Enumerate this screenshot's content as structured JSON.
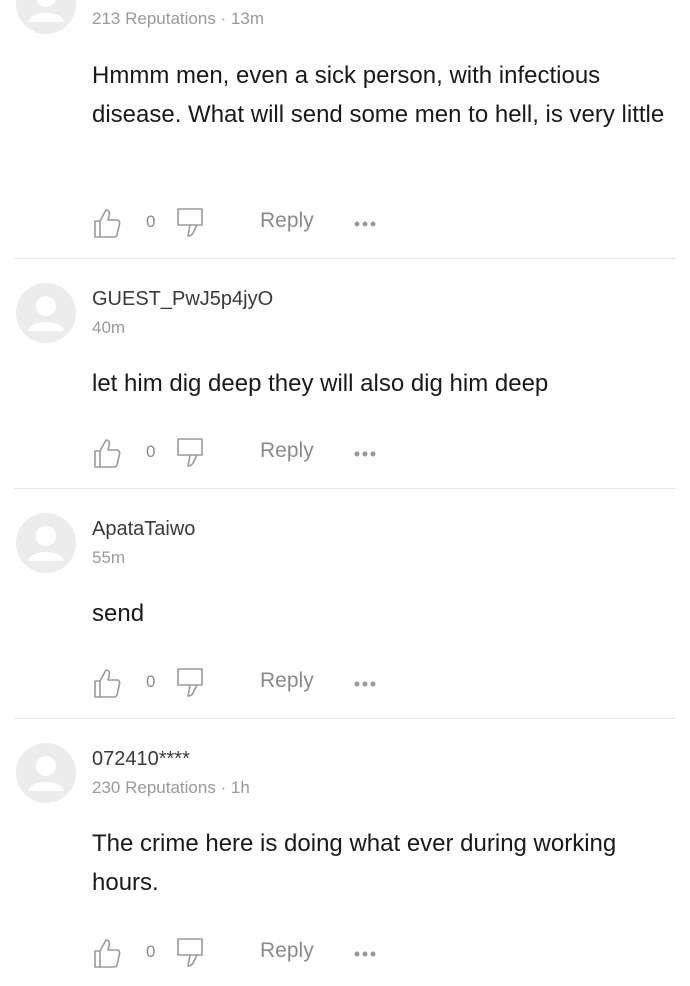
{
  "comments": [
    {
      "author": "",
      "meta": "213 Reputations · 13m",
      "text": "Hmmm men, even a sick person, with infectious disease. What will send some men to hell,  is very little",
      "likes": "0",
      "reply_label": "Reply"
    },
    {
      "author": "GUEST_PwJ5p4jyO",
      "meta": "40m",
      "text": "let him dig deep they will also dig him deep",
      "likes": "0",
      "reply_label": "Reply"
    },
    {
      "author": "ApataTaiwo",
      "meta": "55m",
      "text": "send",
      "likes": "0",
      "reply_label": "Reply"
    },
    {
      "author": "072410****",
      "meta": "230 Reputations · 1h",
      "text": "The crime here is doing what ever during working hours.",
      "likes": "0",
      "reply_label": "Reply"
    }
  ],
  "icons": {
    "like": "thumbs-up-icon",
    "dislike": "thumbs-down-icon",
    "more": "more-options-icon",
    "avatar": "default-avatar-icon"
  },
  "colors": {
    "avatar_bg": "#ececec",
    "avatar_fg": "#ffffff",
    "muted_text": "#8a8a8a",
    "divider": "#e8e8e8"
  }
}
